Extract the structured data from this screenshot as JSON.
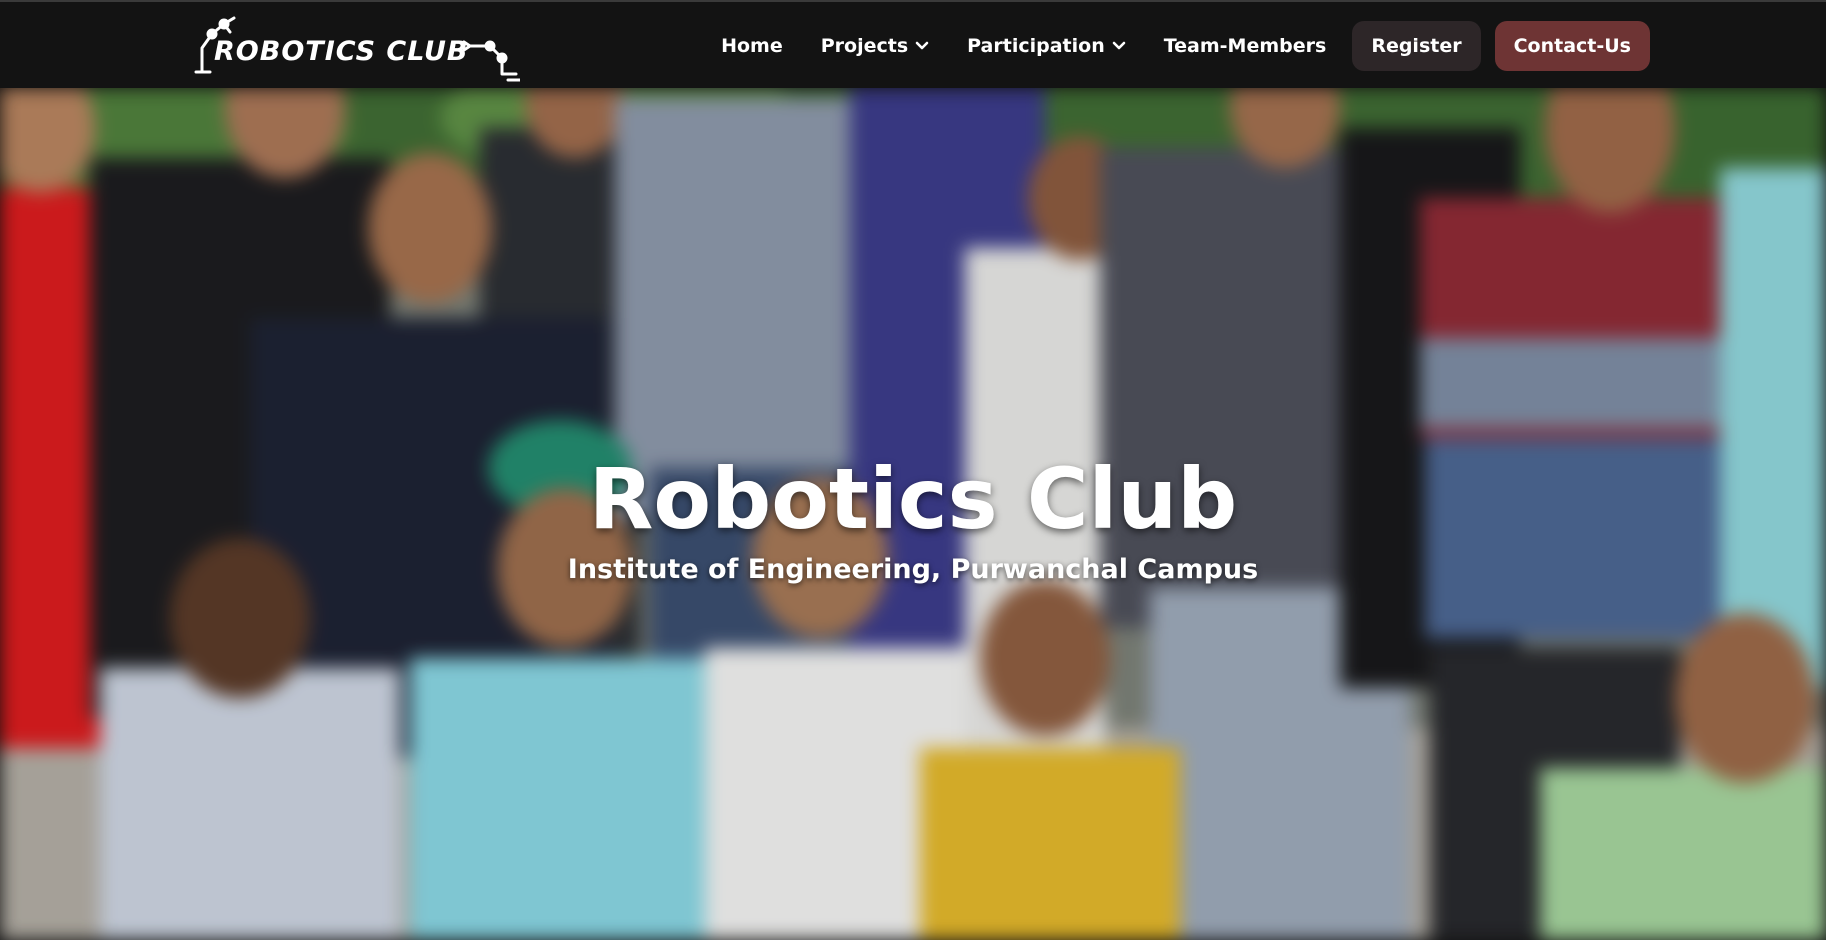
{
  "logo": {
    "text": "ROBOTICS CLUB",
    "icon": "robot-arm-icon"
  },
  "nav": {
    "home": "Home",
    "projects": "Projects",
    "participation": "Participation",
    "team_members": "Team-Members",
    "register": "Register",
    "contact": "Contact-Us"
  },
  "hero": {
    "title": "Robotics Club",
    "subtitle": "Institute of Engineering, Purwanchal Campus",
    "background": "group-photo-of-club-members"
  },
  "colors": {
    "navbar": "#131313",
    "register_button": "#2d2628",
    "contact_button": "#6e3434",
    "text": "#ffffff"
  }
}
